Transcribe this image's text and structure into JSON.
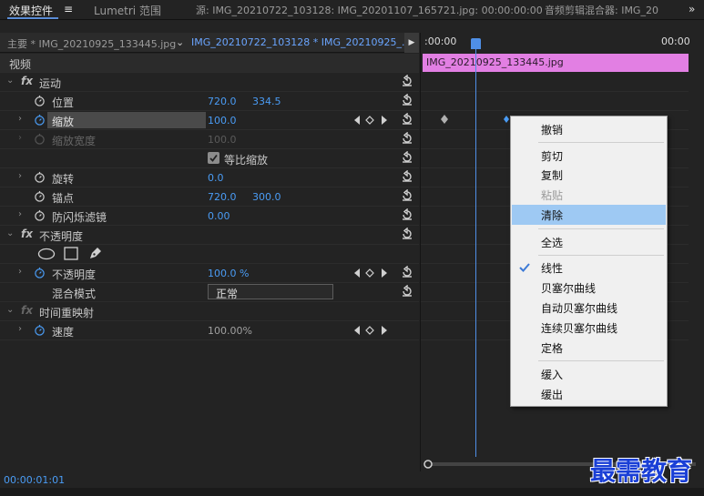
{
  "tabs": {
    "effects_controls": "效果控件",
    "menu_icon": "≡",
    "lumetri": "Lumetri 范围",
    "source": "源: IMG_20210722_103128: IMG_20201107_165721.jpg: 00:00:00:00",
    "audio_mixer": "音频剪辑混合器: IMG_20",
    "overflow": "»"
  },
  "source_bar": {
    "master": "主要 * IMG_20210925_133445.jpg",
    "clip": "IMG_20210722_103128 * IMG_20210925_..."
  },
  "timeline": {
    "timecode_start": ":00:00",
    "timecode_end": "00:00",
    "clip_name": "IMG_20210925_133445.jpg"
  },
  "panel": {
    "video_header": "视频",
    "motion": "运动",
    "position_label": "位置",
    "position_x": "720.0",
    "position_y": "334.5",
    "scale_label": "缩放",
    "scale_value": "100.0",
    "scale_width_label": "缩放宽度",
    "scale_width_value": "100.0",
    "uniform_scale_label": "等比缩放",
    "rotation_label": "旋转",
    "rotation_value": "0.0",
    "anchor_label": "锚点",
    "anchor_x": "720.0",
    "anchor_y": "300.0",
    "flicker_label": "防闪烁滤镜",
    "flicker_value": "0.00",
    "opacity_group": "不透明度",
    "opacity_label": "不透明度",
    "opacity_value": "100.0 %",
    "blend_label": "混合模式",
    "blend_value": "正常",
    "time_remap": "时间重映射",
    "speed_label": "速度",
    "speed_value": "100.00%"
  },
  "current_timecode": "00:00:01:01",
  "context_menu": {
    "undo": "撤销",
    "cut": "剪切",
    "copy": "复制",
    "paste": "粘贴",
    "clear": "清除",
    "select_all": "全选",
    "linear": "线性",
    "bezier": "贝塞尔曲线",
    "auto_bezier": "自动贝塞尔曲线",
    "continuous_bezier": "连续贝塞尔曲线",
    "hold": "定格",
    "ease_in": "缓入",
    "ease_out": "缓出"
  },
  "watermark": "最需教育",
  "colors": {
    "accent_blue": "#4a9cf5",
    "clip_pink": "#e27fe3",
    "menu_highlight": "#9ec9f3"
  }
}
